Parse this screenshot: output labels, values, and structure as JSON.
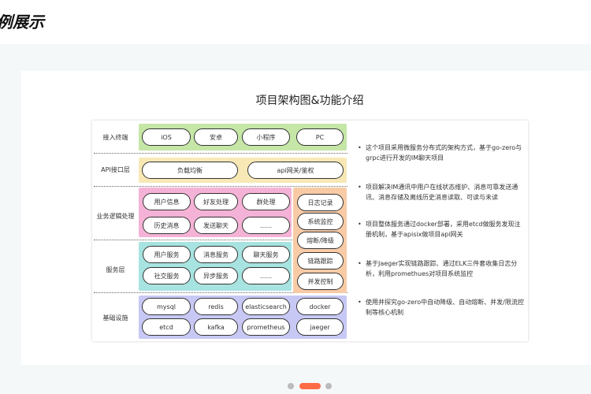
{
  "header": {
    "title": "例展示"
  },
  "title": "项目架构图&功能介绍",
  "colors": {
    "access": "#c5e6a6",
    "api": "#f7e8b5",
    "logic": "#f4b3d6",
    "service": "#a7e3e0",
    "infra": "#c8c8f5",
    "side": "#f8cba6",
    "active_dot": "#ff6b45"
  },
  "layers": [
    {
      "label": "接入终端",
      "items": [
        "iOS",
        "安卓",
        "小程序",
        "PC"
      ]
    },
    {
      "label": "API接口层",
      "items": [
        "负载均衡",
        "api网关/鉴权"
      ]
    },
    {
      "label": "业务逻辑处理",
      "items": [
        "用户信息",
        "好友处理",
        "群处理",
        "历史消息",
        "发送聊天",
        "......"
      ]
    },
    {
      "label": "服务层",
      "items": [
        "用户服务",
        "消息服务",
        "聊天服务",
        "社交服务",
        "异步服务",
        "......"
      ]
    },
    {
      "label": "基础设施",
      "items": [
        "mysql",
        "redis",
        "elasticsearch",
        "docker",
        "etcd",
        "kafka",
        "prometheus",
        "jaeger"
      ]
    }
  ],
  "side": [
    "日志记录",
    "系统监控",
    "熔断/降级",
    "链路跟踪",
    "并发控制"
  ],
  "bullets": [
    "这个项目采用微服务分布式的架构方式，基于go-zero与grpc进行开发的IM聊天项目",
    "项目解决IM通讯中用户在线状态维护、消息可靠发送通讯、消息存储及离线历史消息读取、可读与未读",
    "项目整体服务通过docker部署，采用etcd做服务发现注册机制，基于apisix做项目api网关",
    "基于Jaeger实现链路跟踪、通过ELK三件套收集日志分析，利用promethues对项目系统监控",
    "使用并探究go-zero中自动降级、自动熔断、并发/限流控制等核心机制"
  ],
  "carousel": {
    "count": 3,
    "active": 1
  }
}
